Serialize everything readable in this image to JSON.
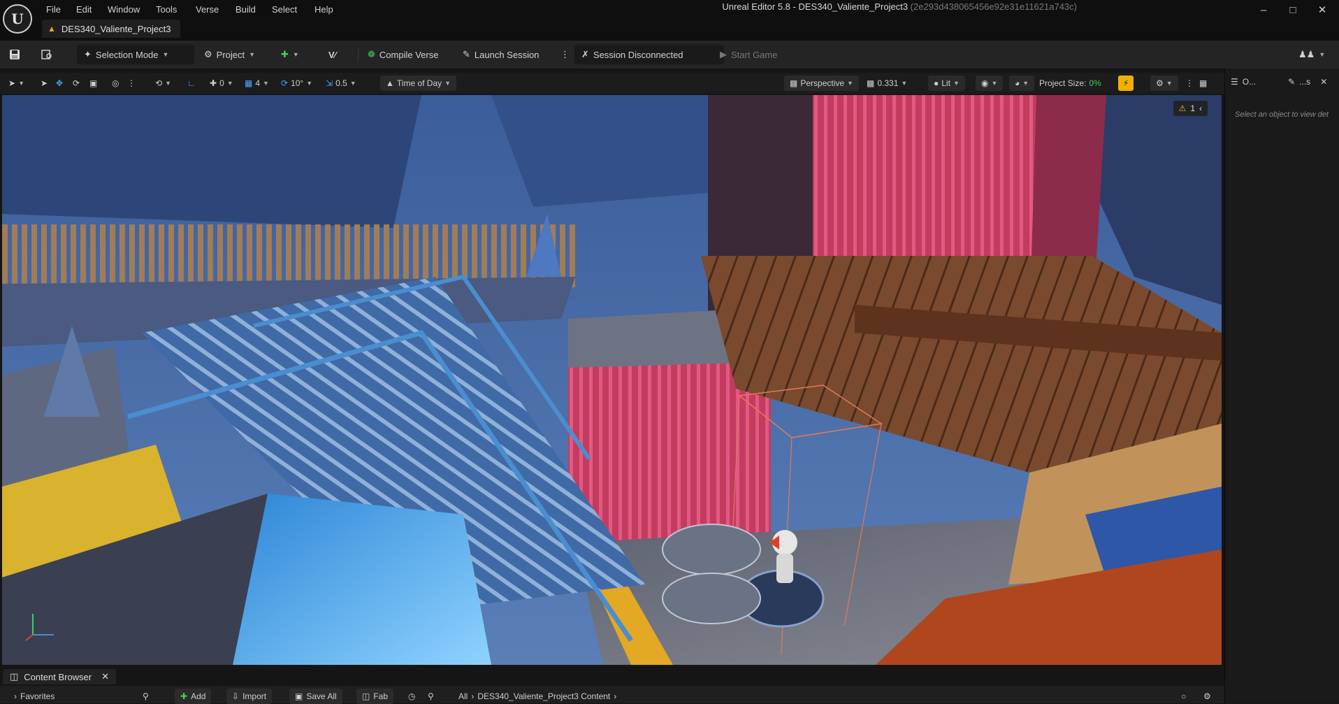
{
  "app": {
    "menu": [
      "File",
      "Edit",
      "Window",
      "Tools",
      "Verse",
      "Build",
      "Select",
      "Help"
    ],
    "window_title": "Unreal Editor 5.8 - DES340_Valiente_Project3",
    "window_hash": "(2e293d438065456e92e31e11621a743c)",
    "project_tab": "DES340_Valiente_Project3"
  },
  "toolbar": {
    "selection_mode": "Selection Mode",
    "project": "Project",
    "compile_verse": "Compile Verse",
    "launch_session": "Launch Session",
    "session_status": "Session Disconnected",
    "start_game": "Start Game"
  },
  "viewport_toolbar": {
    "rotation_snap_value": "0",
    "grid_value": "4",
    "angle_value": "10°",
    "scale_value": "0.5",
    "time_of_day": "Time of Day",
    "perspective": "Perspective",
    "camera_speed": "0.331",
    "view_mode": "Lit",
    "project_size_label": "Project Size:",
    "project_size_value": "0%",
    "warning_count": "1"
  },
  "right_panel": {
    "tab_outliner": "O...",
    "tab_details": "...s",
    "hint": "Select an object to view det"
  },
  "content_browser": {
    "tab_label": "Content Browser",
    "favorites": "Favorites",
    "add": "Add",
    "import": "Import",
    "save_all": "Save All",
    "fab": "Fab",
    "path_all": "All",
    "path_content": "DES340_Valiente_Project3 Content"
  },
  "colors": {
    "accent_green": "#3fcf5a",
    "warning_yellow": "#f5b820",
    "lightning_yellow": "#f0b000"
  }
}
